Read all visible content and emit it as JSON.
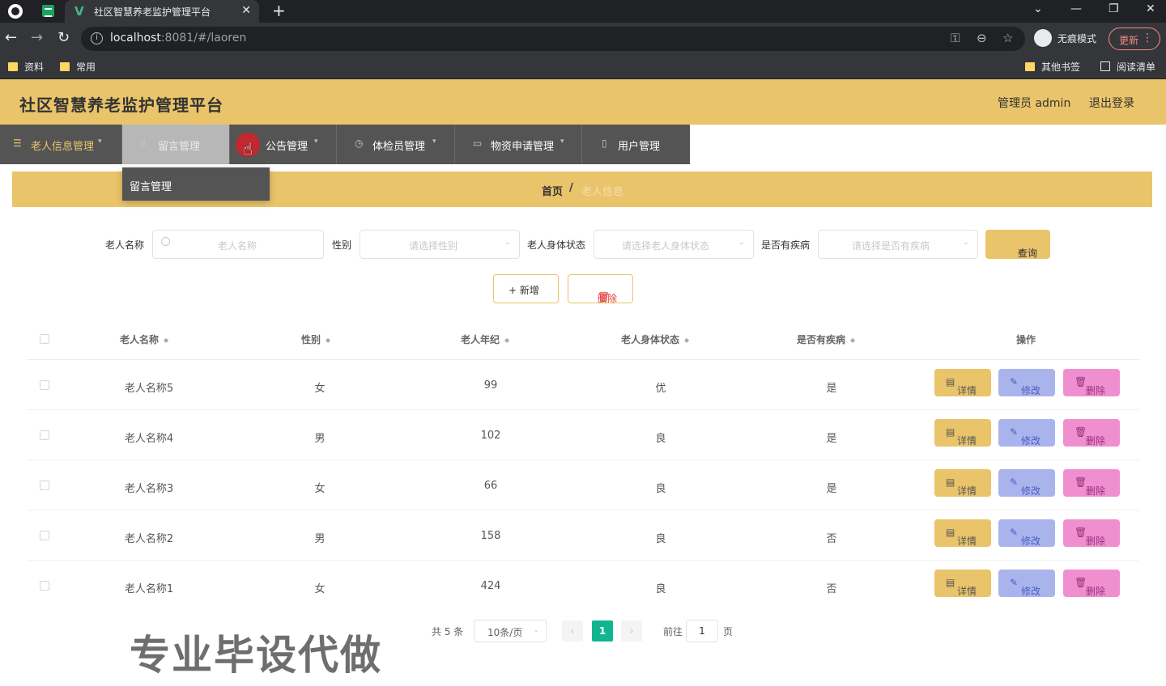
{
  "browser": {
    "tab_title": "社区智慧养老监护管理平台",
    "url_host": "localhost",
    "url_rest": ":8081/#/laoren",
    "incognito_label": "无痕模式",
    "update_label": "更新",
    "bookmarks": [
      "资料",
      "常用"
    ],
    "bookmarks_right": [
      "其他书签",
      "阅读清单"
    ]
  },
  "header": {
    "title": "社区智慧养老监护管理平台",
    "admin": "管理员 admin",
    "logout": "退出登录"
  },
  "menu": {
    "items": [
      {
        "label": "老人信息管理",
        "icon": "menu-icon"
      },
      {
        "label": "留言管理",
        "icon": "chart-icon"
      },
      {
        "label": "公告管理",
        "icon": "notice-icon"
      },
      {
        "label": "体检员管理",
        "icon": "clock-icon"
      },
      {
        "label": "物资申请管理",
        "icon": "box-icon"
      },
      {
        "label": "用户管理",
        "icon": "user-icon"
      }
    ],
    "submenu_label": "留言管理"
  },
  "breadcrumb": {
    "home": "首页",
    "separator": "/",
    "current": "老人信息"
  },
  "search": {
    "name_label": "老人名称",
    "name_placeholder": "老人名称",
    "gender_label": "性别",
    "gender_placeholder": "请选择性别",
    "status_label": "老人身体状态",
    "status_placeholder": "请选择老人身体状态",
    "disease_label": "是否有疾病",
    "disease_placeholder": "请选择是否有疾病",
    "query_label": "查询"
  },
  "actions": {
    "add_label": "+ 新增",
    "delete_label": "删除"
  },
  "table": {
    "headers": [
      "老人名称",
      "性别",
      "老人年纪",
      "老人身体状态",
      "是否有疾病",
      "操作"
    ],
    "rows": [
      {
        "name": "老人名称5",
        "gender": "女",
        "age": "99",
        "status": "优",
        "disease": "是"
      },
      {
        "name": "老人名称4",
        "gender": "男",
        "age": "102",
        "status": "良",
        "disease": "是"
      },
      {
        "name": "老人名称3",
        "gender": "女",
        "age": "66",
        "status": "良",
        "disease": "是"
      },
      {
        "name": "老人名称2",
        "gender": "男",
        "age": "158",
        "status": "良",
        "disease": "否"
      },
      {
        "name": "老人名称1",
        "gender": "女",
        "age": "424",
        "status": "良",
        "disease": "否"
      }
    ],
    "op_detail": "详情",
    "op_edit": "修改",
    "op_delete": "删除"
  },
  "pagination": {
    "total": "共 5 条",
    "page_size": "10条/页",
    "current_page": "1",
    "goto_label": "前往",
    "goto_value": "1",
    "page_unit": "页"
  },
  "watermark": "专业毕设代做",
  "colors": {
    "accent": "#e9c46a",
    "menu_bg": "#545454",
    "page_active": "#13b591"
  }
}
